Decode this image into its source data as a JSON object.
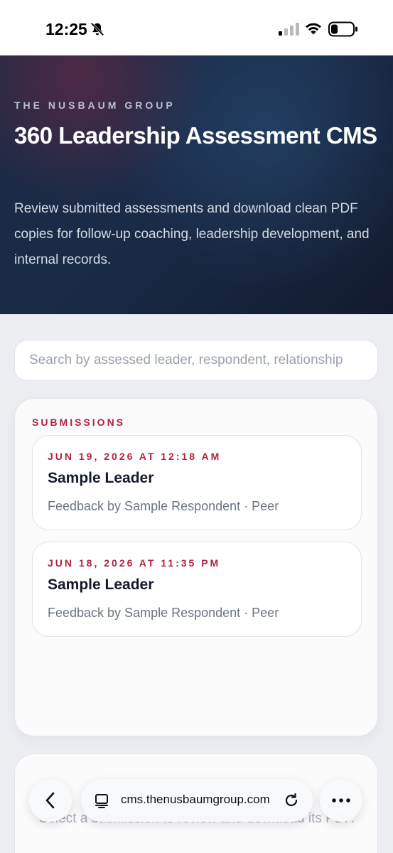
{
  "status_bar": {
    "time": "12:25"
  },
  "hero": {
    "eyebrow": "THE NUSBAUM GROUP",
    "title": "360 Leadership Assessment CMS",
    "description": "Review submitted assessments and download clean PDF copies for follow-up coaching, leadership development, and internal records."
  },
  "search": {
    "placeholder": "Search by assessed leader, respondent, relationship",
    "value": ""
  },
  "submissions": {
    "label": "SUBMISSIONS",
    "items": [
      {
        "date": "JUN 19, 2026 AT 12:18 AM",
        "leader": "Sample Leader",
        "meta": "Feedback by Sample Respondent · Peer"
      },
      {
        "date": "JUN 18, 2026 AT 11:35 PM",
        "leader": "Sample Leader",
        "meta": "Feedback by Sample Respondent · Peer"
      }
    ]
  },
  "detail": {
    "empty_text": "Select a submission to review and download its PDF."
  },
  "browser": {
    "url": "cms.thenusbaumgroup.com"
  },
  "colors": {
    "accent": "#b3223a",
    "hero_bg": "#1a2b48"
  },
  "icons": {
    "bell": "bell-slash-icon",
    "signal": "cellular-signal-icon",
    "wifi": "wifi-icon",
    "battery": "battery-icon",
    "back": "chevron-left-icon",
    "reader": "reader-mode-icon",
    "reload": "reload-icon",
    "more": "ellipsis-icon"
  }
}
